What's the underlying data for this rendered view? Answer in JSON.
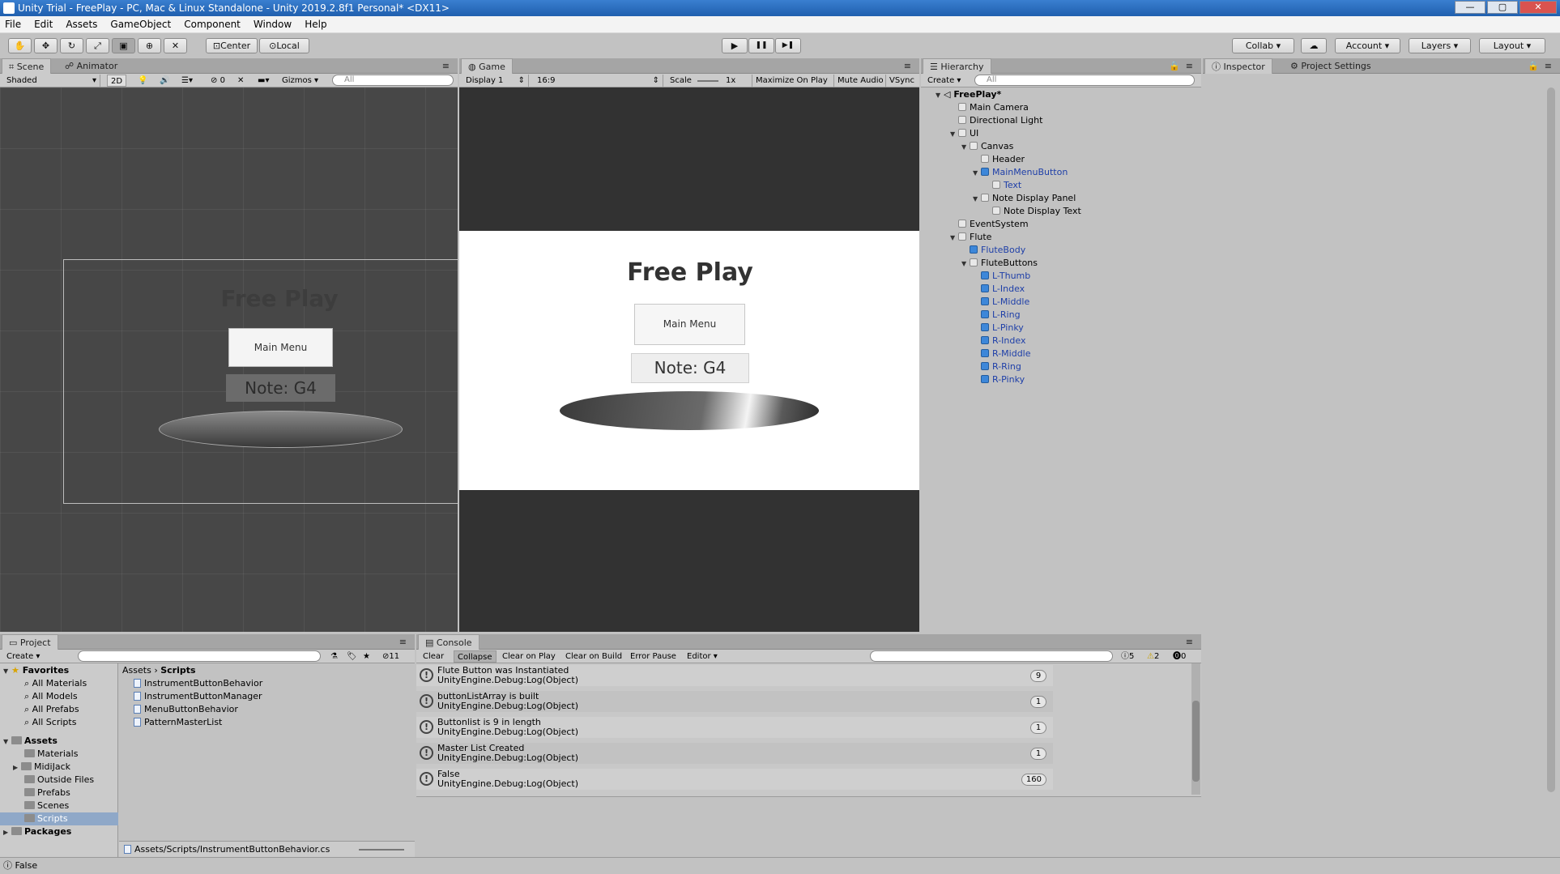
{
  "window": {
    "title": "Unity Trial - FreePlay - PC, Mac & Linux Standalone - Unity 2019.2.8f1 Personal* <DX11>",
    "minimize": "—",
    "maximize": "▢",
    "close": "✕"
  },
  "menu": [
    "File",
    "Edit",
    "Assets",
    "GameObject",
    "Component",
    "Window",
    "Help"
  ],
  "toolbar": {
    "center": "Center",
    "local": "Local",
    "play": "▶",
    "pause": "❚❚",
    "step": "▶❚",
    "collab": "Collab",
    "account": "Account",
    "layers": "Layers",
    "layout": "Layout"
  },
  "scene": {
    "tab_scene": "Scene",
    "tab_animator": "Animator",
    "shaded": "Shaded",
    "mode_2d": "2D",
    "fx_count": "0",
    "gizmos": "Gizmos",
    "search_placeholder": "All",
    "title": "Free Play",
    "button": "Main Menu",
    "note": "Note: G4"
  },
  "game": {
    "tab": "Game",
    "display": "Display 1",
    "aspect": "16:9",
    "scale_label": "Scale",
    "scale_value": "1x",
    "maximize": "Maximize On Play",
    "mute": "Mute Audio",
    "vsync": "VSync",
    "title": "Free Play",
    "button": "Main Menu",
    "note": "Note: G4"
  },
  "hierarchy": {
    "tab": "Hierarchy",
    "create": "Create",
    "search_placeholder": "All",
    "scene_name": "FreePlay*",
    "items": [
      "Main Camera",
      "Directional Light",
      "UI",
      "Canvas",
      "Header",
      "MainMenuButton",
      "Text",
      "Note Display Panel",
      "Note Display Text",
      "EventSystem",
      "Flute",
      "FluteBody",
      "FluteButtons",
      "L-Thumb",
      "L-Index",
      "L-Middle",
      "L-Ring",
      "L-Pinky",
      "R-Index",
      "R-Middle",
      "R-Ring",
      "R-Pinky"
    ]
  },
  "inspector": {
    "tab_inspector": "Inspector",
    "tab_project_settings": "Project Settings"
  },
  "project": {
    "tab": "Project",
    "create": "Create",
    "hidden_count": "11",
    "favorites": "Favorites",
    "fav_items": [
      "All Materials",
      "All Models",
      "All Prefabs",
      "All Scripts"
    ],
    "assets": "Assets",
    "asset_folders": [
      "Materials",
      "MidiJack",
      "Outside Files",
      "Prefabs",
      "Scenes",
      "Scripts"
    ],
    "packages": "Packages",
    "breadcrumb_root": "Assets",
    "breadcrumb_current": "Scripts",
    "files": [
      "InstrumentButtonBehavior",
      "InstrumentButtonManager",
      "MenuButtonBehavior",
      "PatternMasterList"
    ],
    "footer_path": "Assets/Scripts/InstrumentButtonBehavior.cs"
  },
  "console": {
    "tab": "Console",
    "clear": "Clear",
    "collapse": "Collapse",
    "clear_on_play": "Clear on Play",
    "clear_on_build": "Clear on Build",
    "error_pause": "Error Pause",
    "editor": "Editor",
    "log_count": "5",
    "warn_count": "2",
    "error_count": "0",
    "entries": [
      {
        "line1": "Flute Button was Instantiated",
        "line2": "UnityEngine.Debug:Log(Object)",
        "count": "9"
      },
      {
        "line1": "buttonListArray is built",
        "line2": "UnityEngine.Debug:Log(Object)",
        "count": "1"
      },
      {
        "line1": "Buttonlist is 9 in length",
        "line2": "UnityEngine.Debug:Log(Object)",
        "count": "1"
      },
      {
        "line1": "Master List Created",
        "line2": "UnityEngine.Debug:Log(Object)",
        "count": "1"
      },
      {
        "line1": "False",
        "line2": "UnityEngine.Debug:Log(Object)",
        "count": "160"
      }
    ]
  },
  "statusbar": {
    "text": "False"
  }
}
